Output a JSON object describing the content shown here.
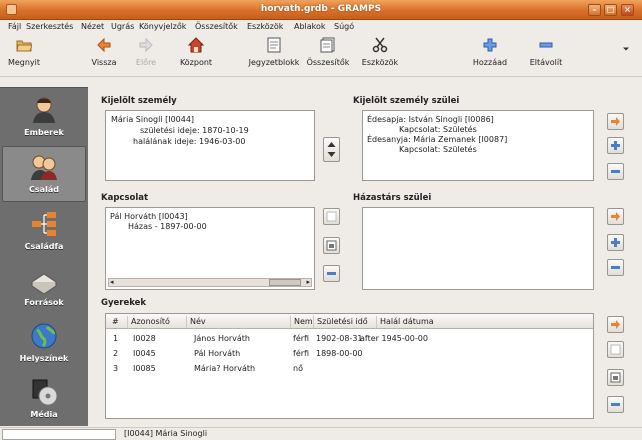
{
  "window": {
    "title": "horvath.grdb - GRAMPS"
  },
  "menubar": [
    "Fájl",
    "Szerkesztés",
    "Nézet",
    "Ugrás",
    "Könyvjelzők",
    "Összesítők",
    "Eszközök",
    "Ablakok",
    "Súgó"
  ],
  "toolbar": {
    "items": [
      {
        "label": "Megnyit",
        "icon": "folder-open-icon",
        "enabled": true
      },
      {
        "label": "Vissza",
        "icon": "back-arrow-icon",
        "enabled": true
      },
      {
        "label": "Előre",
        "icon": "forward-arrow-icon",
        "enabled": false
      },
      {
        "label": "Központ",
        "icon": "home-icon",
        "enabled": true
      },
      {
        "label": "Jegyzetblokk",
        "icon": "notepad-icon",
        "enabled": true
      },
      {
        "label": "Összesítők",
        "icon": "reports-icon",
        "enabled": true
      },
      {
        "label": "Eszközök",
        "icon": "scissors-icon",
        "enabled": true
      },
      {
        "label": "Hozzáad",
        "icon": "add-icon",
        "enabled": true
      },
      {
        "label": "Eltávolít",
        "icon": "remove-icon",
        "enabled": true
      }
    ]
  },
  "sidebar": {
    "items": [
      {
        "label": "Emberek",
        "icon": "people-icon",
        "active": false
      },
      {
        "label": "Család",
        "icon": "family-icon",
        "active": true
      },
      {
        "label": "Családfa",
        "icon": "family-tree-icon",
        "active": false
      },
      {
        "label": "Források",
        "icon": "sources-icon",
        "active": false
      },
      {
        "label": "Helyszínek",
        "icon": "globe-icon",
        "active": false
      },
      {
        "label": "Média",
        "icon": "media-icon",
        "active": false
      }
    ]
  },
  "active_person": {
    "title": "Kijelölt személy",
    "lines": [
      "Mária Sinogli [I0044]",
      "születési ideje: 1870-10-19",
      "halálának ideje: 1946-03-00"
    ]
  },
  "active_parents": {
    "title": "Kijelölt személy szülei",
    "lines": [
      "Édesapja: István Sinogli [I0086]",
      "Kapcsolat: Születés",
      "Édesanyja: Mária Zemanek [I0087]",
      "Kapcsolat: Születés"
    ]
  },
  "relationship": {
    "title": "Kapcsolat",
    "lines": [
      "Pál Horváth [I0043]",
      "Házas - 1897-00-00"
    ]
  },
  "spouse_parents": {
    "title": "Házastárs szülei",
    "lines": []
  },
  "children": {
    "title": "Gyerekek",
    "columns": [
      "#",
      "Azonosító",
      "Név",
      "Nem",
      "Születési idő",
      "Halál dátuma"
    ],
    "rows": [
      [
        "1",
        "I0028",
        "János Horváth",
        "férfi",
        "1902-08-31",
        "after 1945-00-00"
      ],
      [
        "2",
        "I0045",
        "Pál Horváth",
        "férfi",
        "1898-00-00",
        ""
      ],
      [
        "3",
        "I0085",
        "Mária? Horváth",
        "nő",
        "",
        ""
      ]
    ]
  },
  "status": {
    "text": "[I0044] Mária Sinogli"
  },
  "colors": {
    "titlebar": "#d9702a",
    "sidebar": "#6e6e6e",
    "accent_orange": "#e8832f",
    "accent_blue": "#4a7fc8"
  }
}
